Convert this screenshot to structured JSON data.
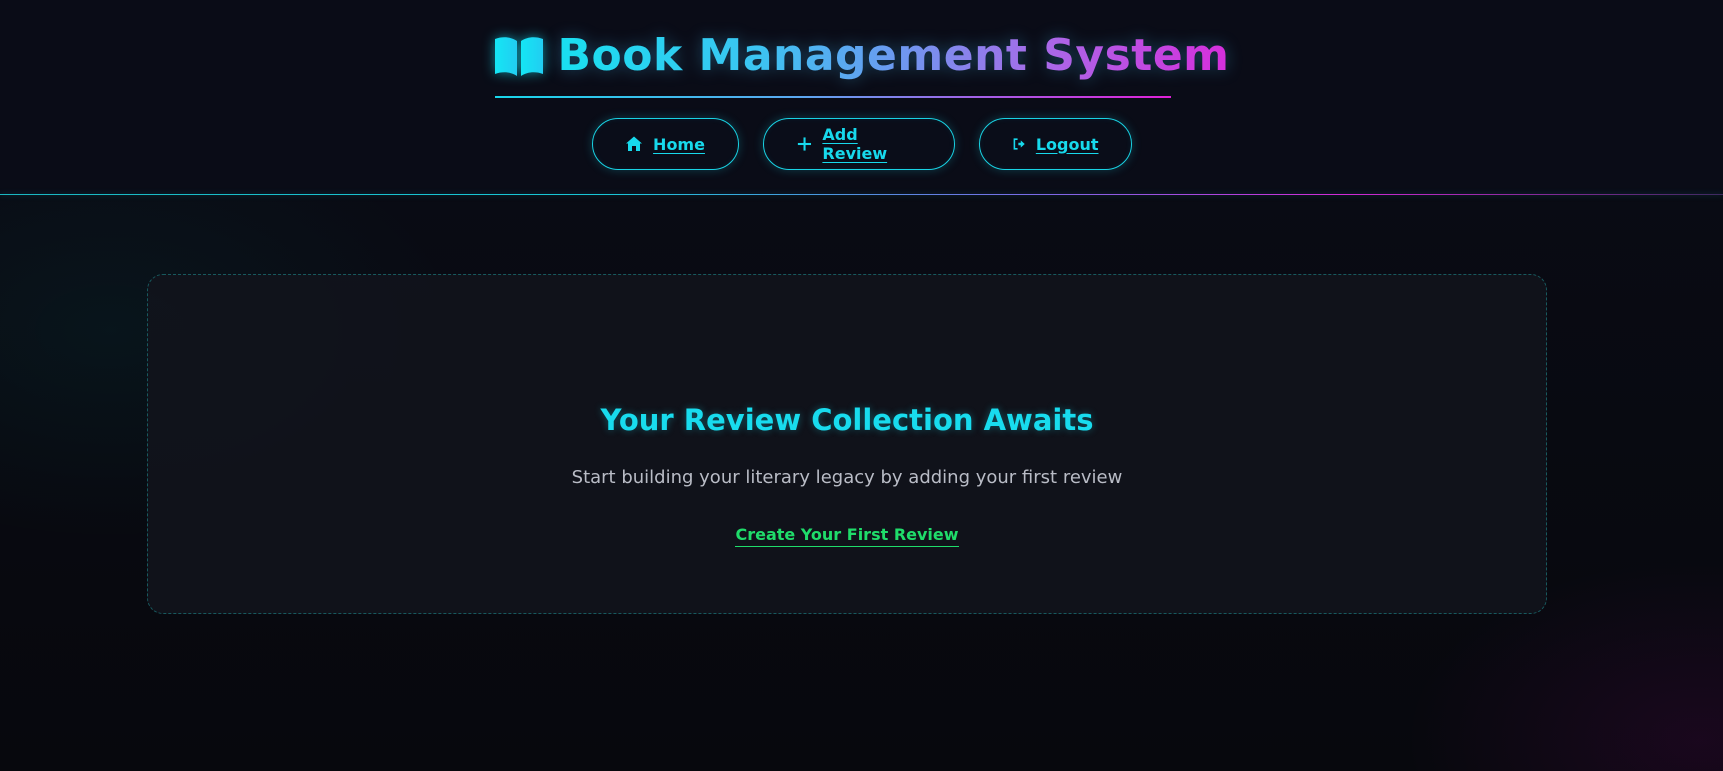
{
  "header": {
    "title": "Book Management System",
    "icon": "book-open-icon"
  },
  "nav": {
    "items": [
      {
        "label": "Home",
        "icon": "home-icon"
      },
      {
        "label": "Add Review",
        "icon": "plus-icon"
      },
      {
        "label": "Logout",
        "icon": "logout-icon"
      }
    ]
  },
  "empty_state": {
    "title": "Your Review Collection Awaits",
    "subtitle": "Start building your literary legacy by adding your first review",
    "cta_label": "Create Your First Review"
  },
  "colors": {
    "accent_cyan": "#18dcee",
    "accent_magenta": "#d62edc",
    "cta_green": "#1fdc6a",
    "background": "#080910"
  }
}
